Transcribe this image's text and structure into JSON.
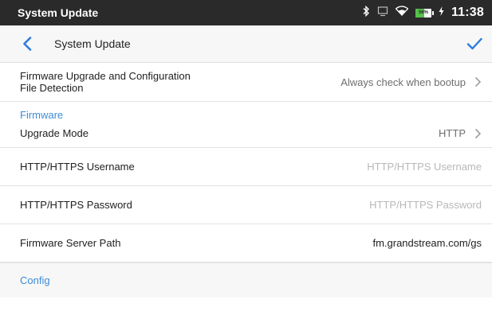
{
  "statusbar": {
    "title": "System Update",
    "time": "11:38",
    "battery": {
      "percent_label": "56%",
      "level": 0.56,
      "charging": true
    },
    "icons": [
      "bluetooth-icon",
      "screen-cast-icon",
      "wifi-icon",
      "battery-icon",
      "charging-bolt-icon"
    ]
  },
  "toolbar": {
    "title": "System Update",
    "back_icon": "back-arrow-icon",
    "confirm_icon": "checkmark-icon",
    "accent": "#2d7be0"
  },
  "rows": {
    "detection": {
      "label_line1": "Firmware Upgrade and Configuration",
      "label_line2": "File Detection",
      "value": "Always check when bootup"
    },
    "firmware_section": "Firmware",
    "upgrade_mode": {
      "label": "Upgrade Mode",
      "value": "HTTP"
    },
    "username": {
      "label": "HTTP/HTTPS Username",
      "placeholder": "HTTP/HTTPS Username"
    },
    "password": {
      "label": "HTTP/HTTPS Password",
      "placeholder": "HTTP/HTTPS Password"
    },
    "server_path": {
      "label": "Firmware Server Path",
      "value": "fm.grandstream.com/gs"
    },
    "config_section": "Config"
  }
}
